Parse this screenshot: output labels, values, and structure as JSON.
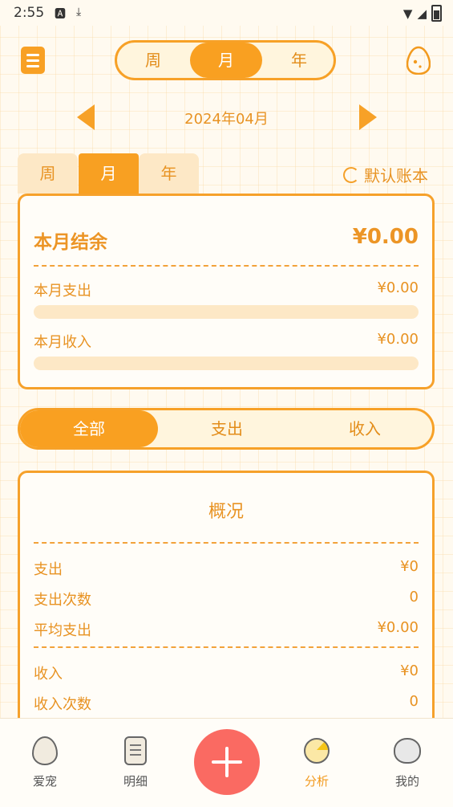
{
  "status_bar": {
    "time": "2:55"
  },
  "period_segment": {
    "options": [
      "周",
      "月",
      "年"
    ],
    "selected": "月"
  },
  "month_nav": {
    "label": "2024年04月"
  },
  "tabs": {
    "options": [
      "周",
      "月",
      "年"
    ],
    "selected": "月"
  },
  "account_book": {
    "label": "默认账本"
  },
  "balance_card": {
    "balance_label": "本月结余",
    "balance_value": "¥0.00",
    "expense_label": "本月支出",
    "expense_value": "¥0.00",
    "expense_progress": 0,
    "income_label": "本月收入",
    "income_value": "¥0.00",
    "income_progress": 0
  },
  "filter": {
    "options": [
      "全部",
      "支出",
      "收入"
    ],
    "selected": "全部"
  },
  "overview": {
    "title": "概况",
    "rows": [
      {
        "label": "支出",
        "value": "¥0"
      },
      {
        "label": "支出次数",
        "value": "0"
      },
      {
        "label": "平均支出",
        "value": "¥0.00"
      },
      {
        "label": "收入",
        "value": "¥0"
      },
      {
        "label": "收入次数",
        "value": "0"
      }
    ]
  },
  "bottom_nav": {
    "items": [
      {
        "label": "爱宠",
        "icon": "egg-icon"
      },
      {
        "label": "明细",
        "icon": "notepad-icon"
      },
      {
        "label": "",
        "icon": "add-icon"
      },
      {
        "label": "分析",
        "icon": "pie-chart-icon",
        "active": true
      },
      {
        "label": "我的",
        "icon": "cat-face-icon"
      }
    ]
  },
  "colors": {
    "accent": "#f8a022",
    "accent_light": "#fde8c6",
    "add_button": "#fa6a62"
  }
}
